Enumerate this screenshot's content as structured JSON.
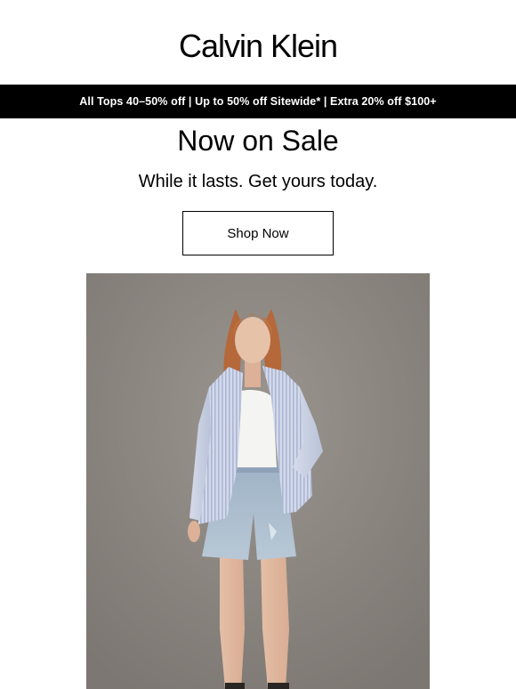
{
  "brand": {
    "logo_text": "Calvin Klein"
  },
  "promo": {
    "text": "All Tops 40–50% off | Up to 50% off Sitewide* | Extra 20% off $100+"
  },
  "main": {
    "headline": "Now on Sale",
    "subhead": "While it lasts. Get yours today.",
    "cta_label": "Shop Now"
  },
  "hero": {
    "alt": "Model wearing striped button-up shirt, white tank and light-wash denim shorts"
  },
  "colors": {
    "promo_bg": "#000000",
    "promo_text": "#ffffff",
    "hero_bg": "#8a8580",
    "shirt": "#c9d0e2",
    "denim": "#a9bccd"
  }
}
